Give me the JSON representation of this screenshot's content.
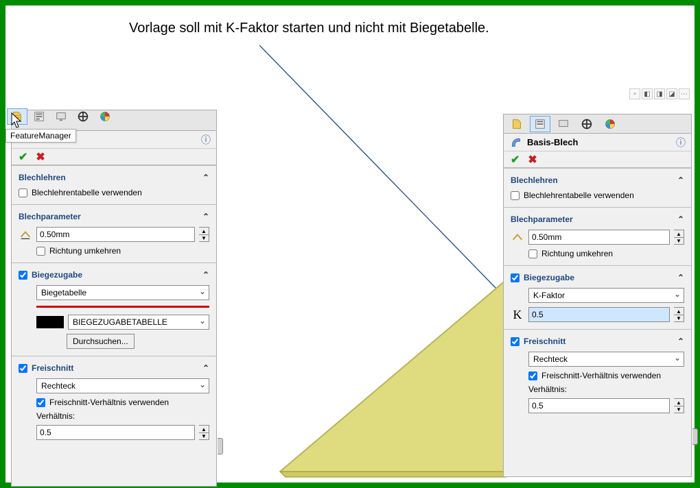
{
  "annotation": "Vorlage soll mit K-Faktor starten und nicht mit Biegetabelle.",
  "tooltip": "FeatureManager",
  "left_panel": {
    "title": "",
    "sections": {
      "blechlehren": {
        "title": "Blechlehren",
        "use_table": "Blechlehrentabelle verwenden",
        "use_table_checked": false
      },
      "blechparameter": {
        "title": "Blechparameter",
        "thickness": "0.50mm",
        "reverse": "Richtung umkehren",
        "reverse_checked": false
      },
      "biegezugabe": {
        "title": "Biegezugabe",
        "combo": "Biegetabelle",
        "table_name": "BIEGEZUGABETABELLE",
        "browse": "Durchsuchen..."
      },
      "freischnitt": {
        "title": "Freischnitt",
        "type": "Rechteck",
        "use_ratio": "Freischnitt-Verhältnis verwenden",
        "use_ratio_checked": true,
        "ratio_label": "Verhältnis:",
        "ratio": "0.5"
      }
    }
  },
  "right_panel": {
    "title": "Basis-Blech",
    "sections": {
      "blechlehren": {
        "title": "Blechlehren",
        "use_table": "Blechlehrentabelle verwenden",
        "use_table_checked": false
      },
      "blechparameter": {
        "title": "Blechparameter",
        "thickness": "0.50mm",
        "reverse": "Richtung umkehren",
        "reverse_checked": false
      },
      "biegezugabe": {
        "title": "Biegezugabe",
        "combo": "K-Faktor",
        "k_value": "0.5"
      },
      "freischnitt": {
        "title": "Freischnitt",
        "type": "Rechteck",
        "use_ratio": "Freischnitt-Verhältnis verwenden",
        "use_ratio_checked": true,
        "ratio_label": "Verhältnis:",
        "ratio": "0.5"
      }
    }
  },
  "icons": {
    "feature_mgr": "feature-manager",
    "config": "configuration-manager",
    "display": "display-manager",
    "appearance": "appearance-manager",
    "dim": "dimexpert-manager"
  }
}
